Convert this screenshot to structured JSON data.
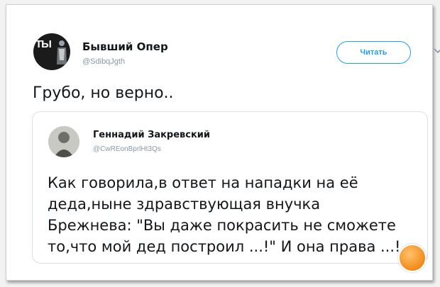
{
  "tweet": {
    "author": {
      "name": "Бывший Опер",
      "handle": "@SdibqJgth",
      "avatar_text": "ТЫ"
    },
    "follow_label": "Читать",
    "text": "Грубо, но верно.."
  },
  "quoted_tweet": {
    "author": {
      "name": "Геннадий Закревский",
      "handle": "@CwREonBprlHt3Qs"
    },
    "text": "Как говорила,в ответ на нападки на её\nдеда,ныне здравствующая внучка\nБрежнева: \"Вы даже покрасить не сможете\nто,что мой дед построил ...!\" И она права ...!"
  },
  "colors": {
    "accent": "#1da1f2",
    "text": "#14171a",
    "muted": "#8899a6",
    "watermark": "#f28a1a"
  },
  "icons": {
    "menu": "chevron-down-icon",
    "watermark": "site-logo-icon"
  }
}
